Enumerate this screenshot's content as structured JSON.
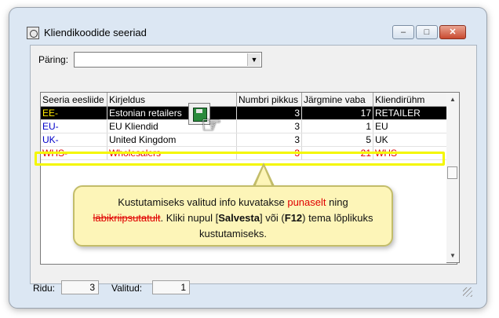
{
  "window": {
    "title": "Kliendikoodide seeriad"
  },
  "query": {
    "label": "Päring:",
    "value": ""
  },
  "table": {
    "columns": [
      "Seeria eesliide",
      "Kirjeldus",
      "Numbri pikkus",
      "Järgmine vaba",
      "Kliendirühm"
    ],
    "rows": [
      {
        "prefix": "EE-",
        "description": "Estonian retailers",
        "length": "3",
        "next": "17",
        "group": "RETAILER"
      },
      {
        "prefix": "EU-",
        "description": "EU Kliendid",
        "length": "3",
        "next": "1",
        "group": "EU"
      },
      {
        "prefix": "UK-",
        "description": "United Kingdom",
        "length": "3",
        "next": "5",
        "group": "UK"
      },
      {
        "prefix": "WHS-",
        "description": "Wholesalers",
        "length": "3",
        "next": "21",
        "group": "WHS"
      }
    ]
  },
  "callout": {
    "part1": "Kustutamiseks valitud info kuvatakse ",
    "red_word": "punaselt",
    "part2": " ning",
    "strike_word": "läbikriipsutatult",
    "part3": ". Kliki nupul [",
    "bold1": "Salvesta",
    "part4": "] või (",
    "bold2": "F12",
    "part5": ") tema lõplikuks kustutamiseks."
  },
  "status": {
    "rows_label": "Ridu:",
    "rows_value": "3",
    "selected_label": "Valitud:",
    "selected_value": "1"
  },
  "colors": {
    "selected_bg": "#000000",
    "selected_prefix": "#ffea00",
    "deleted": "#e00000",
    "highlight": "#f4f700",
    "callout_bg": "#fdf5b8"
  }
}
